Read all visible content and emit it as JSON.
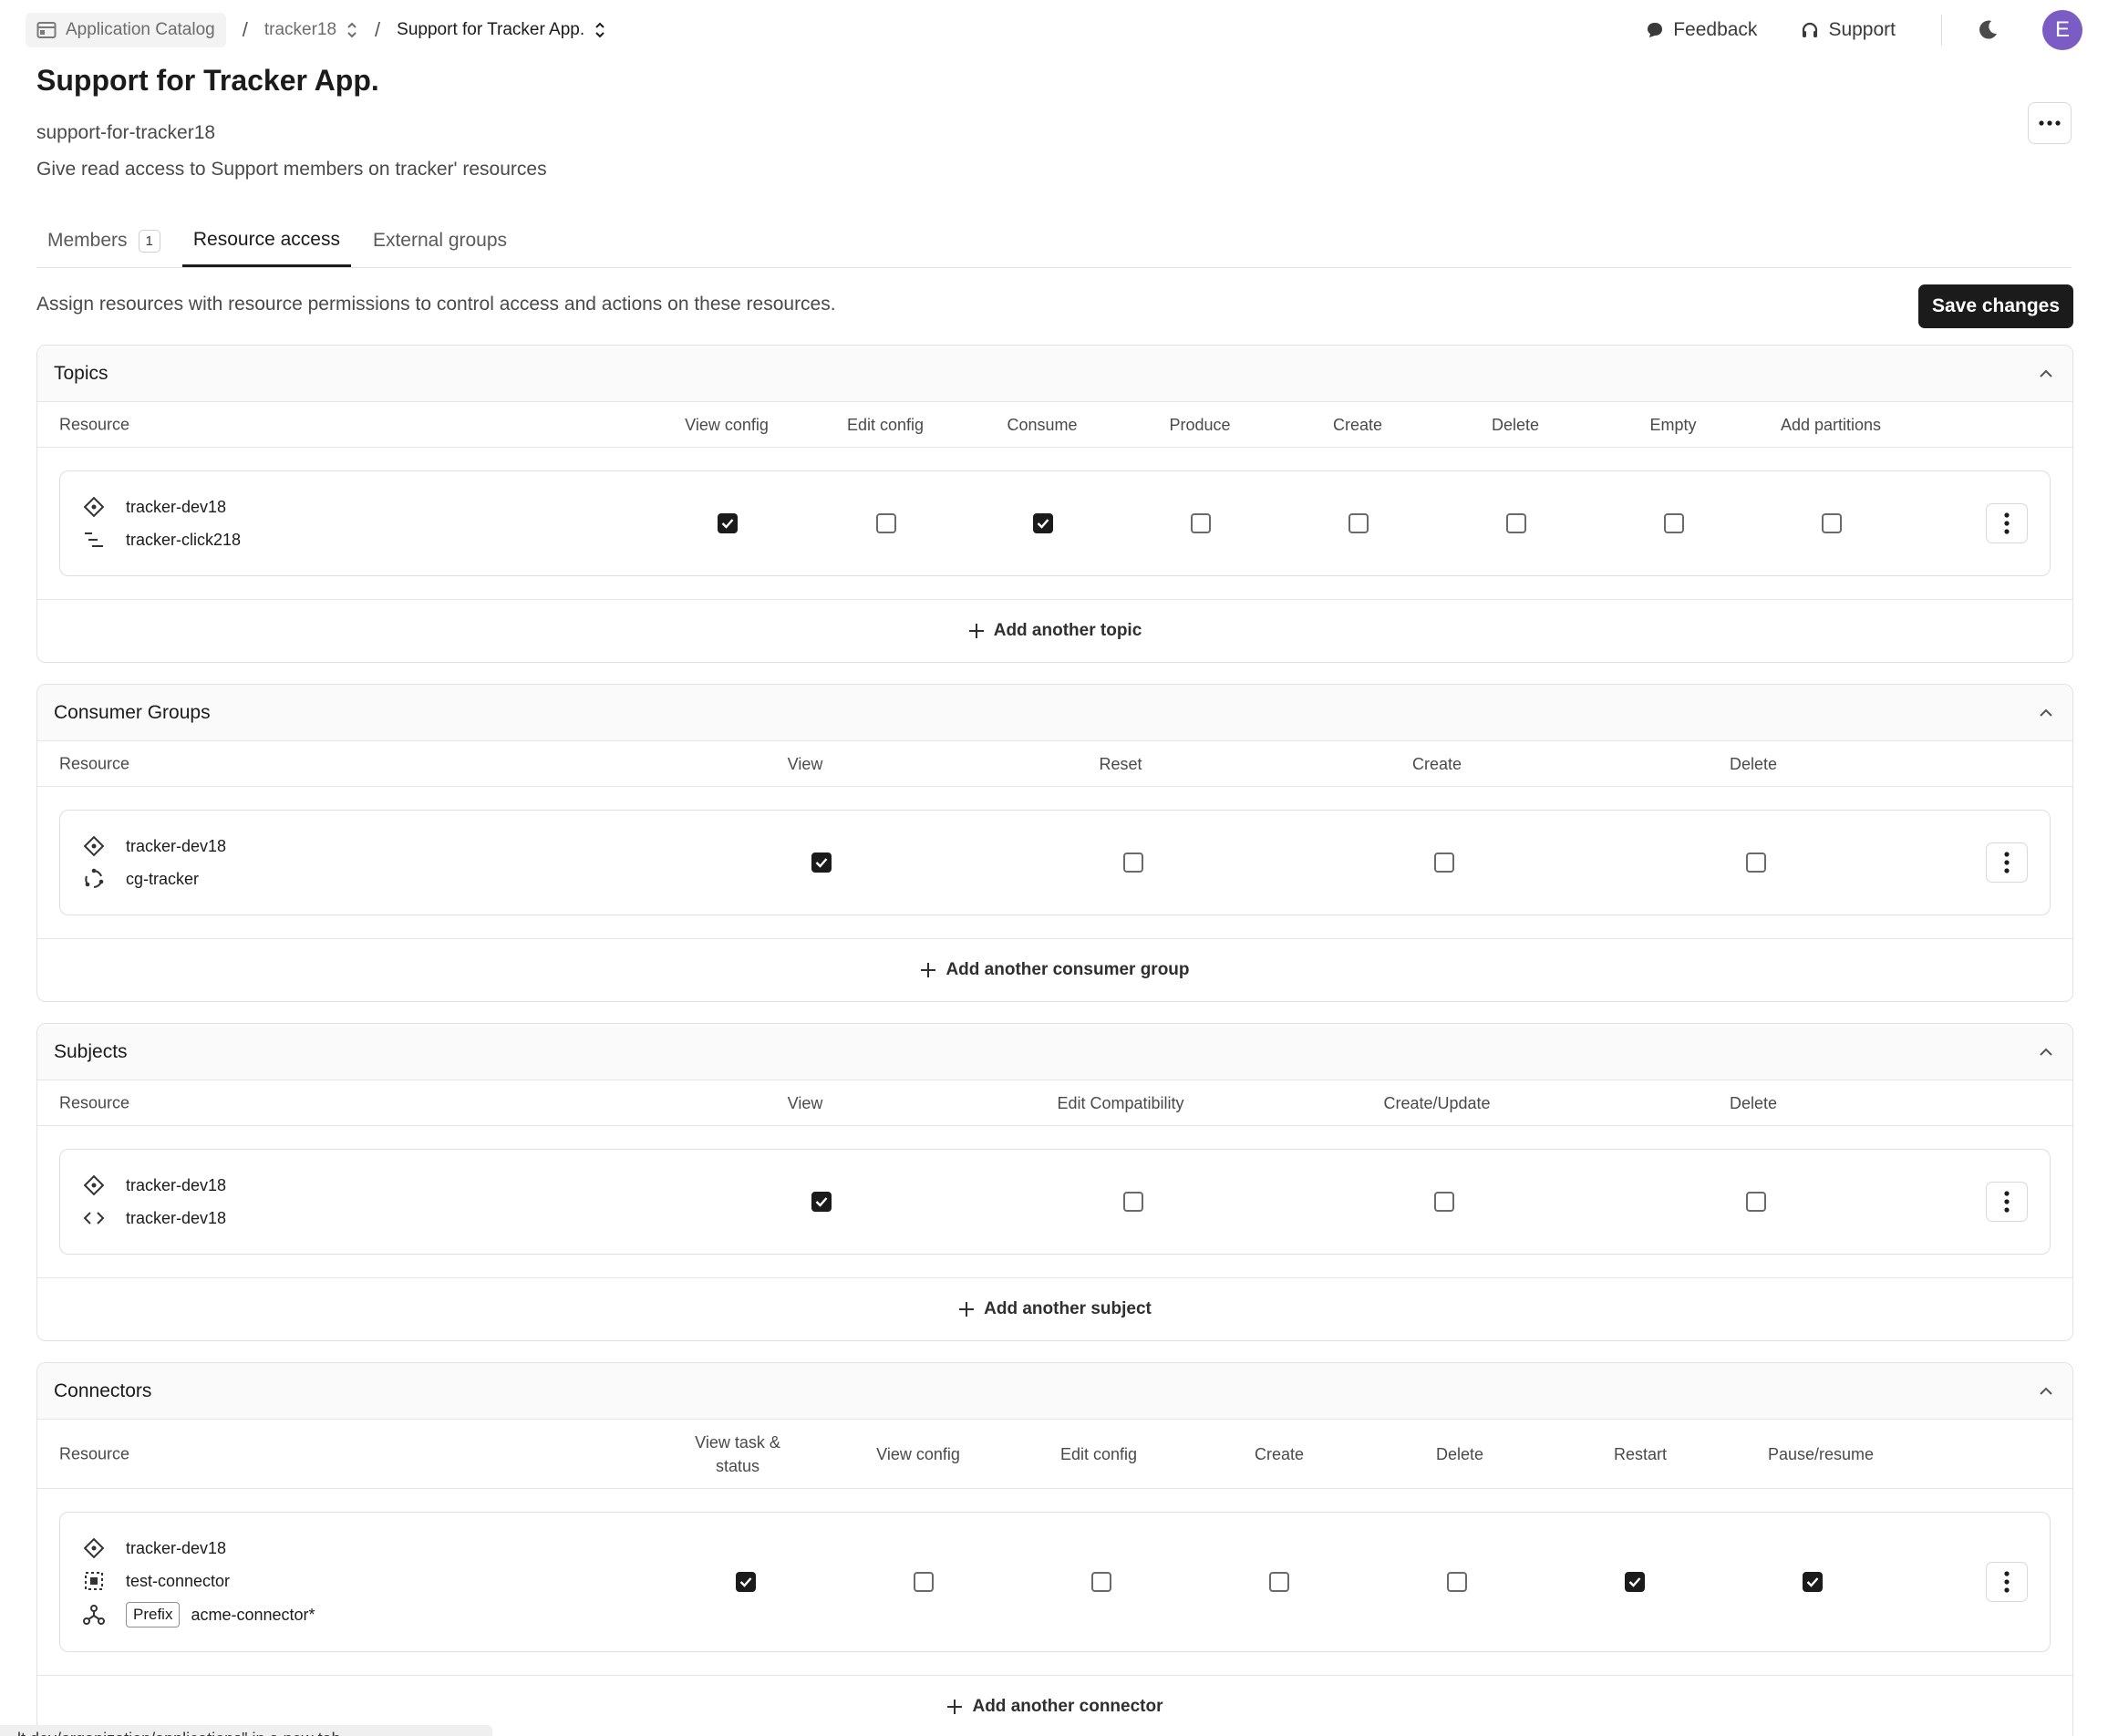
{
  "breadcrumb": {
    "items": [
      {
        "label": "Application Catalog"
      },
      {
        "label": "tracker18"
      },
      {
        "label": "Support for Tracker App."
      }
    ],
    "separator": "/"
  },
  "topbar": {
    "feedback": "Feedback",
    "support": "Support",
    "avatar_initial": "E"
  },
  "header": {
    "title": "Support for Tracker App.",
    "slug": "support-for-tracker18",
    "description": "Give read access to Support members on tracker' resources"
  },
  "tabs": [
    {
      "label": "Members",
      "count": "1"
    },
    {
      "label": "Resource access"
    },
    {
      "label": "External groups"
    }
  ],
  "resource_access": {
    "intro": "Assign resources with resource permissions to control access and actions on these resources.",
    "save_label": "Save changes"
  },
  "sections": {
    "topics": {
      "title": "Topics",
      "resource_header": "Resource",
      "columns": [
        "View config",
        "Edit config",
        "Consume",
        "Produce",
        "Create",
        "Delete",
        "Empty",
        "Add partitions"
      ],
      "row": {
        "lines": [
          {
            "icon": "cluster-icon",
            "text": "tracker-dev18"
          },
          {
            "icon": "topic-icon",
            "text": "tracker-click218"
          }
        ],
        "checked": [
          true,
          false,
          true,
          false,
          false,
          false,
          false,
          false
        ]
      },
      "add_label": "Add another topic"
    },
    "consumer_groups": {
      "title": "Consumer Groups",
      "resource_header": "Resource",
      "columns": [
        "View",
        "Reset",
        "Create",
        "Delete"
      ],
      "row": {
        "lines": [
          {
            "icon": "cluster-icon",
            "text": "tracker-dev18"
          },
          {
            "icon": "consumer-group-icon",
            "text": "cg-tracker"
          }
        ],
        "checked": [
          true,
          false,
          false,
          false
        ]
      },
      "add_label": "Add another consumer group"
    },
    "subjects": {
      "title": "Subjects",
      "resource_header": "Resource",
      "columns": [
        "View",
        "Edit Compatibility",
        "Create/Update",
        "Delete"
      ],
      "row": {
        "lines": [
          {
            "icon": "cluster-icon",
            "text": "tracker-dev18"
          },
          {
            "icon": "code-icon",
            "text": "tracker-dev18"
          }
        ],
        "checked": [
          true,
          false,
          false,
          false
        ]
      },
      "add_label": "Add another subject"
    },
    "connectors": {
      "title": "Connectors",
      "resource_header": "Resource",
      "columns": [
        "View task & status",
        "View config",
        "Edit config",
        "Create",
        "Delete",
        "Restart",
        "Pause/resume"
      ],
      "row": {
        "lines": [
          {
            "icon": "cluster-icon",
            "text": "tracker-dev18"
          },
          {
            "icon": "connect-cluster-icon",
            "text": "test-connector"
          },
          {
            "icon": "connector-icon",
            "badge": "Prefix",
            "text": "acme-connector*"
          }
        ],
        "checked": [
          true,
          false,
          false,
          false,
          false,
          true,
          true
        ]
      },
      "add_label": "Add another connector"
    }
  },
  "status_bar": {
    "url_hint": "...lt.dev/organization/applications\" in a new tab"
  }
}
